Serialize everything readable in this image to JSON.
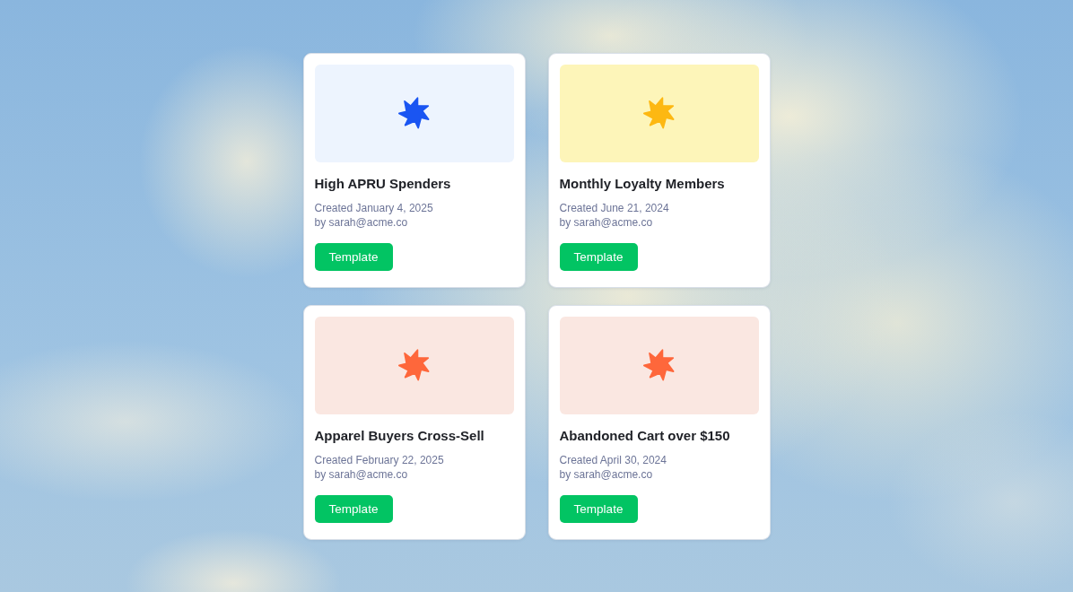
{
  "cards": [
    {
      "title": "High APRU Spenders",
      "created": "Created January 4, 2025",
      "author": "by sarah@acme.co",
      "button": "Template",
      "tile": {
        "color": "#edf4fe"
      },
      "icon": {
        "color": "#1a55f2"
      }
    },
    {
      "title": "Monthly Loyalty Members",
      "created": "Created June 21, 2024",
      "author": "by sarah@acme.co",
      "button": "Template",
      "tile": {
        "color": "#fdf5b9"
      },
      "icon": {
        "color": "#fdb812"
      }
    },
    {
      "title": "Apparel Buyers Cross-Sell",
      "created": "Created February 22, 2025",
      "author": "by sarah@acme.co",
      "button": "Template",
      "tile": {
        "color": "#fae7e1"
      },
      "icon": {
        "color": "#fe673b"
      }
    },
    {
      "title": "Abandoned Cart over $150",
      "created": "Created April 30, 2024",
      "author": "by sarah@acme.co",
      "button": "Template",
      "tile": {
        "color": "#fae7e1"
      },
      "icon": {
        "color": "#fe673b"
      }
    }
  ]
}
